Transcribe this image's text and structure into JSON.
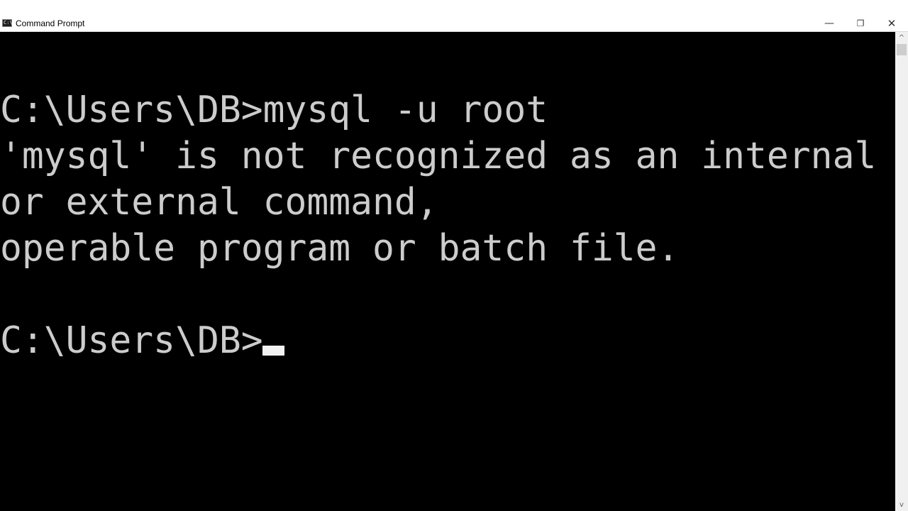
{
  "window": {
    "title": "Command Prompt",
    "app_icon": "cmd-icon",
    "app_icon_text": "C:\\",
    "controls": {
      "minimize": "—",
      "restore": "❐",
      "close": "✕"
    }
  },
  "console": {
    "lines": [
      "C:\\Users\\DB>mysql -u root",
      "'mysql' is not recognized as an internal",
      "or external command,",
      "operable program or batch file.",
      "",
      "C:\\Users\\DB>"
    ],
    "cursor": "block-underline-cursor"
  },
  "scrollbar": {
    "up": "^",
    "down": "v"
  }
}
